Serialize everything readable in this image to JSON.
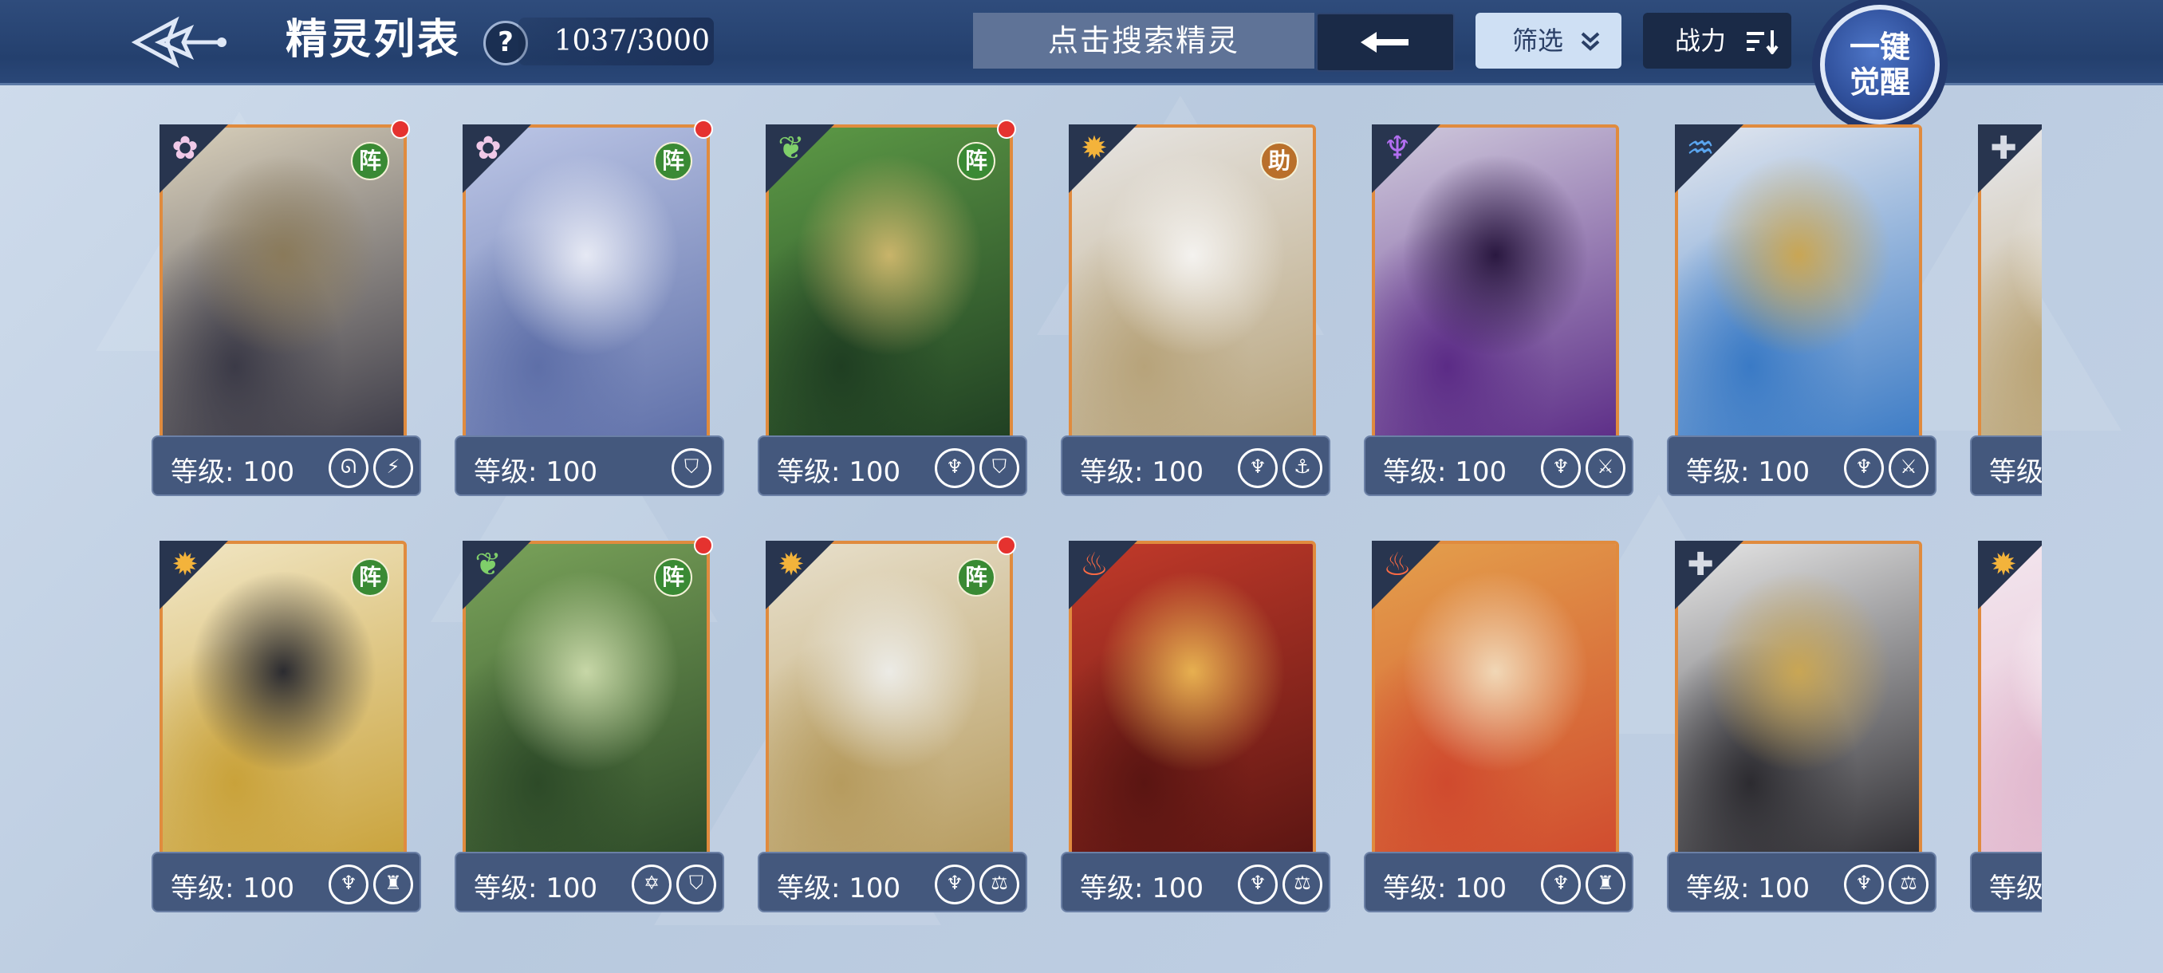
{
  "header": {
    "title": "精灵列表",
    "help_glyph": "?",
    "count": "1037/3000",
    "search_placeholder": "点击搜索精灵",
    "filter_label": "筛选",
    "power_label": "战力",
    "awaken_line1": "一键",
    "awaken_line2": "觉醒"
  },
  "cards": [
    {
      "level": "等级: 100",
      "element": "crystal-icon",
      "badge": "阵",
      "badge_color": "#3a8a34",
      "dot": true,
      "stats": [
        "dragon-icon",
        "lightning-icon"
      ],
      "theme": [
        "#d9d0bb",
        "#3b3a47",
        "#8a7a5a"
      ]
    },
    {
      "level": "等级: 100",
      "element": "crystal-icon",
      "badge": "阵",
      "badge_color": "#3a8a34",
      "dot": true,
      "stats": [
        "shield-icon"
      ],
      "theme": [
        "#bcc6e6",
        "#5e6fa8",
        "#e6e9f4"
      ]
    },
    {
      "level": "等级: 100",
      "element": "leaf-icon",
      "badge": "阵",
      "badge_color": "#3a8a34",
      "dot": true,
      "stats": [
        "trident-icon",
        "shield-icon"
      ],
      "theme": [
        "#5d9a46",
        "#1f3e22",
        "#c9b46a"
      ]
    },
    {
      "level": "等级: 100",
      "element": "sun-icon",
      "badge": "助",
      "badge_color": "#b9702b",
      "dot": false,
      "stats": [
        "trident-icon",
        "anchor-icon"
      ],
      "theme": [
        "#e7e5e3",
        "#b7a37a",
        "#f4f2ef"
      ]
    },
    {
      "level": "等级: 100",
      "element": "demon-icon",
      "badge": "",
      "badge_color": "",
      "dot": false,
      "stats": [
        "trident-icon",
        "claw-icon"
      ],
      "theme": [
        "#cfc9dc",
        "#5b2b86",
        "#2a1840"
      ]
    },
    {
      "level": "等级: 100",
      "element": "water-icon",
      "badge": "",
      "badge_color": "",
      "dot": false,
      "stats": [
        "trident-icon",
        "claw-icon"
      ],
      "theme": [
        "#e3e7ef",
        "#3a7ac5",
        "#c9a654"
      ]
    },
    {
      "level": "等级",
      "element": "cross-icon",
      "badge": "",
      "badge_color": "",
      "dot": false,
      "stats": [],
      "theme": [
        "#e7e8ec",
        "#b9a272",
        "#f3f3f3"
      ]
    },
    {
      "level": "等级: 100",
      "element": "sun-icon",
      "badge": "阵",
      "badge_color": "#3a8a34",
      "dot": false,
      "stats": [
        "trident-icon",
        "warrior-icon"
      ],
      "theme": [
        "#f1e6c4",
        "#c9a23a",
        "#2b2b30"
      ]
    },
    {
      "level": "等级: 100",
      "element": "leaf-icon",
      "badge": "阵",
      "badge_color": "#3a8a34",
      "dot": true,
      "stats": [
        "star-icon",
        "shield-icon"
      ],
      "theme": [
        "#7aa35a",
        "#2d4a28",
        "#c7d7a7"
      ]
    },
    {
      "level": "等级: 100",
      "element": "sun-icon",
      "badge": "阵",
      "badge_color": "#3a8a34",
      "dot": true,
      "stats": [
        "trident-icon",
        "scale-icon"
      ],
      "theme": [
        "#e8e0cc",
        "#b69b5e",
        "#ecebe6"
      ]
    },
    {
      "level": "等级: 100",
      "element": "fire-icon",
      "badge": "",
      "badge_color": "",
      "dot": false,
      "stats": [
        "trident-icon",
        "scale-icon"
      ],
      "theme": [
        "#c23a2a",
        "#5a1512",
        "#e7b050"
      ]
    },
    {
      "level": "等级: 100",
      "element": "fire-icon",
      "badge": "",
      "badge_color": "",
      "dot": false,
      "stats": [
        "trident-icon",
        "warrior-icon"
      ],
      "theme": [
        "#e4a04c",
        "#d04a2e",
        "#f1d7b6"
      ]
    },
    {
      "level": "等级: 100",
      "element": "cross-icon",
      "badge": "",
      "badge_color": "",
      "dot": false,
      "stats": [
        "trident-icon",
        "scale-icon"
      ],
      "theme": [
        "#e6e6e6",
        "#2c2b30",
        "#c9a654"
      ]
    },
    {
      "level": "等级",
      "element": "sun-icon",
      "badge": "",
      "badge_color": "",
      "dot": false,
      "stats": [],
      "theme": [
        "#f3e6ee",
        "#e1b7cd",
        "#ffffff"
      ]
    }
  ]
}
